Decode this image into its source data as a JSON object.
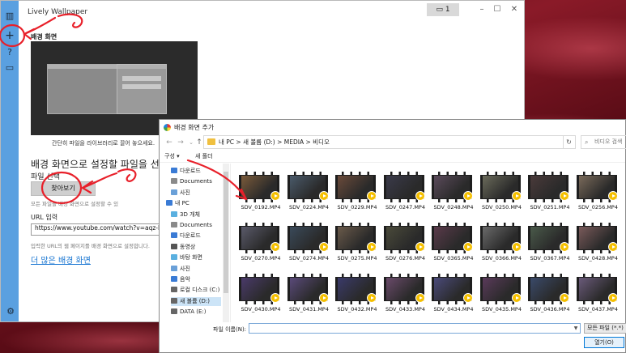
{
  "app": {
    "title": "Lively Wallpaper",
    "monitor_label": "1",
    "rail_icons": [
      "library-icon",
      "add-icon",
      "help-icon",
      "chat-icon"
    ]
  },
  "main": {
    "section_title": "배경 화면",
    "drop_caption": "간단히 파일을 라이브러리로 끌어 놓으세요.",
    "choose_heading": "배경 화면으로 설정할 파일을 선택하거나",
    "file_label": "파일 선택",
    "browse_label": "찾아보기",
    "file_note": "모든 파일을 배경 화면으로 설정할 수 있",
    "url_label": "URL 입력",
    "url_value": "https://www.youtube.com/watch?v=aqz-KE-",
    "url_note": "입력한 URL의 웹 페이지를 배경 화면으로 설정합니다.",
    "more_link": "더 많은 배경 화면"
  },
  "dialog": {
    "title": "배경 화면 추가",
    "address": "내 PC  >  새 볼륨 (D:)  >  MEDIA  >  비디오",
    "search_placeholder": "비디오 검색",
    "organize": "구성 ▾",
    "new_folder": "새 폴더",
    "nav": [
      "다운로드",
      "Documents",
      "사진",
      "내 PC",
      "3D 개체",
      "Documents",
      "다운로드",
      "동영상",
      "바탕 화면",
      "사진",
      "음악",
      "로컬 디스크 (C:)",
      "새 볼륨 (D:)",
      "DATA (E:)"
    ],
    "files": [
      "SDV_0192.MP4",
      "SDV_0224.MP4",
      "SDV_0229.MP4",
      "SDV_0247.MP4",
      "SDV_0248.MP4",
      "SDV_0250.MP4",
      "SDV_0251.MP4",
      "SDV_0256.MP4",
      "SDV_0270.MP4",
      "SDV_0274.MP4",
      "SDV_0275.MP4",
      "SDV_0276.MP4",
      "SDV_0365.MP4",
      "SDV_0366.MP4",
      "SDV_0367.MP4",
      "SDV_0428.MP4",
      "SDV_0430.MP4",
      "SDV_0431.MP4",
      "SDV_0432.MP4",
      "SDV_0433.MP4",
      "SDV_0434.MP4",
      "SDV_0435.MP4",
      "SDV_0436.MP4",
      "SDV_0437.MP4"
    ],
    "filename_label": "파일 이름(N):",
    "filter": "모든 파일 (*.*)",
    "open_label": "열기(O)"
  },
  "colors": {
    "rail": "#5aa0e0",
    "link": "#1976d2",
    "annotation": "#e8202a",
    "play_badge": "#f5c000"
  }
}
